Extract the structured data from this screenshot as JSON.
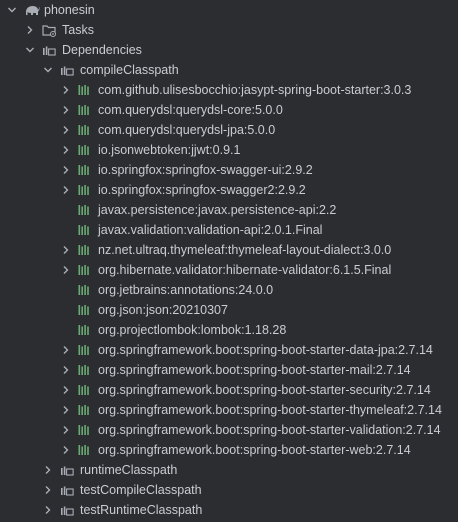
{
  "project": {
    "name": "phonesin",
    "icon": "gradle-elephant-icon"
  },
  "tasks": {
    "label": "Tasks",
    "icon": "folder-config-icon"
  },
  "dependencies": {
    "label": "Dependencies",
    "icon": "folder-library-icon"
  },
  "compileClasspath": {
    "label": "compileClasspath",
    "icon": "folder-library-icon",
    "items": [
      {
        "label": "com.github.ulisesbocchio:jasypt-spring-boot-starter:3.0.3",
        "expandable": true
      },
      {
        "label": "com.querydsl:querydsl-core:5.0.0",
        "expandable": true
      },
      {
        "label": "com.querydsl:querydsl-jpa:5.0.0",
        "expandable": true
      },
      {
        "label": "io.jsonwebtoken:jjwt:0.9.1",
        "expandable": true
      },
      {
        "label": "io.springfox:springfox-swagger-ui:2.9.2",
        "expandable": true
      },
      {
        "label": "io.springfox:springfox-swagger2:2.9.2",
        "expandable": true
      },
      {
        "label": "javax.persistence:javax.persistence-api:2.2",
        "expandable": false
      },
      {
        "label": "javax.validation:validation-api:2.0.1.Final",
        "expandable": false
      },
      {
        "label": "nz.net.ultraq.thymeleaf:thymeleaf-layout-dialect:3.0.0",
        "expandable": true
      },
      {
        "label": "org.hibernate.validator:hibernate-validator:6.1.5.Final",
        "expandable": true
      },
      {
        "label": "org.jetbrains:annotations:24.0.0",
        "expandable": false
      },
      {
        "label": "org.json:json:20210307",
        "expandable": false
      },
      {
        "label": "org.projectlombok:lombok:1.18.28",
        "expandable": false
      },
      {
        "label": "org.springframework.boot:spring-boot-starter-data-jpa:2.7.14",
        "expandable": true
      },
      {
        "label": "org.springframework.boot:spring-boot-starter-mail:2.7.14",
        "expandable": true
      },
      {
        "label": "org.springframework.boot:spring-boot-starter-security:2.7.14",
        "expandable": true
      },
      {
        "label": "org.springframework.boot:spring-boot-starter-thymeleaf:2.7.14",
        "expandable": true
      },
      {
        "label": "org.springframework.boot:spring-boot-starter-validation:2.7.14",
        "expandable": true
      },
      {
        "label": "org.springframework.boot:spring-boot-starter-web:2.7.14",
        "expandable": true
      }
    ]
  },
  "runtimeClasspath": {
    "label": "runtimeClasspath"
  },
  "testCompileClasspath": {
    "label": "testCompileClasspath"
  },
  "testRuntimeClasspath": {
    "label": "testRuntimeClasspath"
  },
  "colors": {
    "background": "#2b2d30",
    "text": "#c9ccd2",
    "library_icon": "#6aab73",
    "chevron": "#a9adb5",
    "folder": "#a9adb5"
  }
}
